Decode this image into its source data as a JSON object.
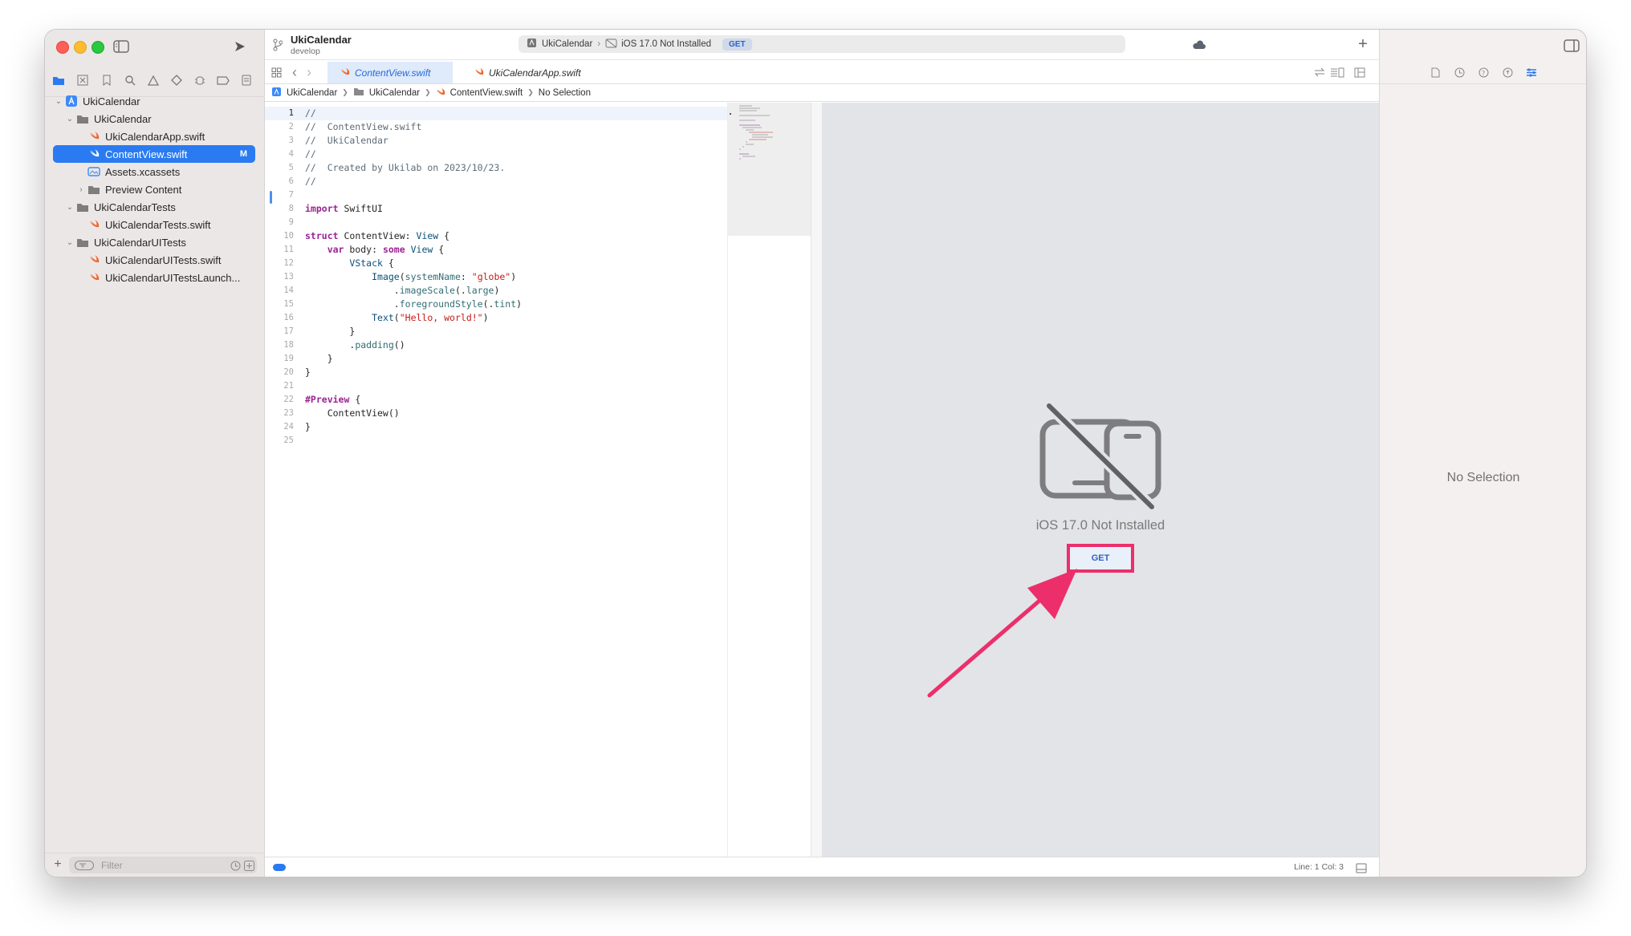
{
  "window": {
    "project_name": "UkiCalendar",
    "branch": "develop"
  },
  "scheme": {
    "target": "UkiCalendar",
    "destination": "iOS 17.0 Not Installed",
    "get_label": "GET"
  },
  "tabs": [
    {
      "label": "ContentView.swift",
      "active": true
    },
    {
      "label": "UkiCalendarApp.swift",
      "active": false
    }
  ],
  "jumpbar": [
    "UkiCalendar",
    "UkiCalendar",
    "ContentView.swift",
    "No Selection"
  ],
  "navigator": {
    "items": [
      {
        "label": "UkiCalendar",
        "kind": "project",
        "depth": 0,
        "expanded": true
      },
      {
        "label": "UkiCalendar",
        "kind": "folder",
        "depth": 1,
        "expanded": true
      },
      {
        "label": "UkiCalendarApp.swift",
        "kind": "swift",
        "depth": 2
      },
      {
        "label": "ContentView.swift",
        "kind": "swift",
        "depth": 2,
        "selected": true,
        "badge": "M"
      },
      {
        "label": "Assets.xcassets",
        "kind": "assets",
        "depth": 2
      },
      {
        "label": "Preview Content",
        "kind": "folder",
        "depth": 2,
        "expanded": false
      },
      {
        "label": "UkiCalendarTests",
        "kind": "folder",
        "depth": 1,
        "expanded": true
      },
      {
        "label": "UkiCalendarTests.swift",
        "kind": "swift",
        "depth": 2
      },
      {
        "label": "UkiCalendarUITests",
        "kind": "folder",
        "depth": 1,
        "expanded": true
      },
      {
        "label": "UkiCalendarUITests.swift",
        "kind": "swift",
        "depth": 2
      },
      {
        "label": "UkiCalendarUITestsLaunch...",
        "kind": "swift",
        "depth": 2
      }
    ],
    "filter_placeholder": "Filter"
  },
  "editor": {
    "lines": [
      "//",
      "//  ContentView.swift",
      "//  UkiCalendar",
      "//",
      "//  Created by Ukilab on 2023/10/23.",
      "//",
      "",
      "import SwiftUI",
      "",
      "struct ContentView: View {",
      "    var body: some View {",
      "        VStack {",
      "            Image(systemName: \"globe\")",
      "                .imageScale(.large)",
      "                .foregroundStyle(.tint)",
      "            Text(\"Hello, world!\")",
      "        }",
      "        .padding()",
      "    }",
      "}",
      "",
      "#Preview {",
      "    ContentView()",
      "}",
      ""
    ],
    "current_line": 1
  },
  "preview": {
    "message": "iOS 17.0 Not Installed",
    "get_label": "GET"
  },
  "status": {
    "position": "Line: 1  Col: 3"
  },
  "inspector": {
    "empty_label": "No Selection"
  },
  "colors": {
    "accent": "#2a7bf1",
    "annotation": "#ec2f6b",
    "swift_orange": "#f0682d"
  }
}
